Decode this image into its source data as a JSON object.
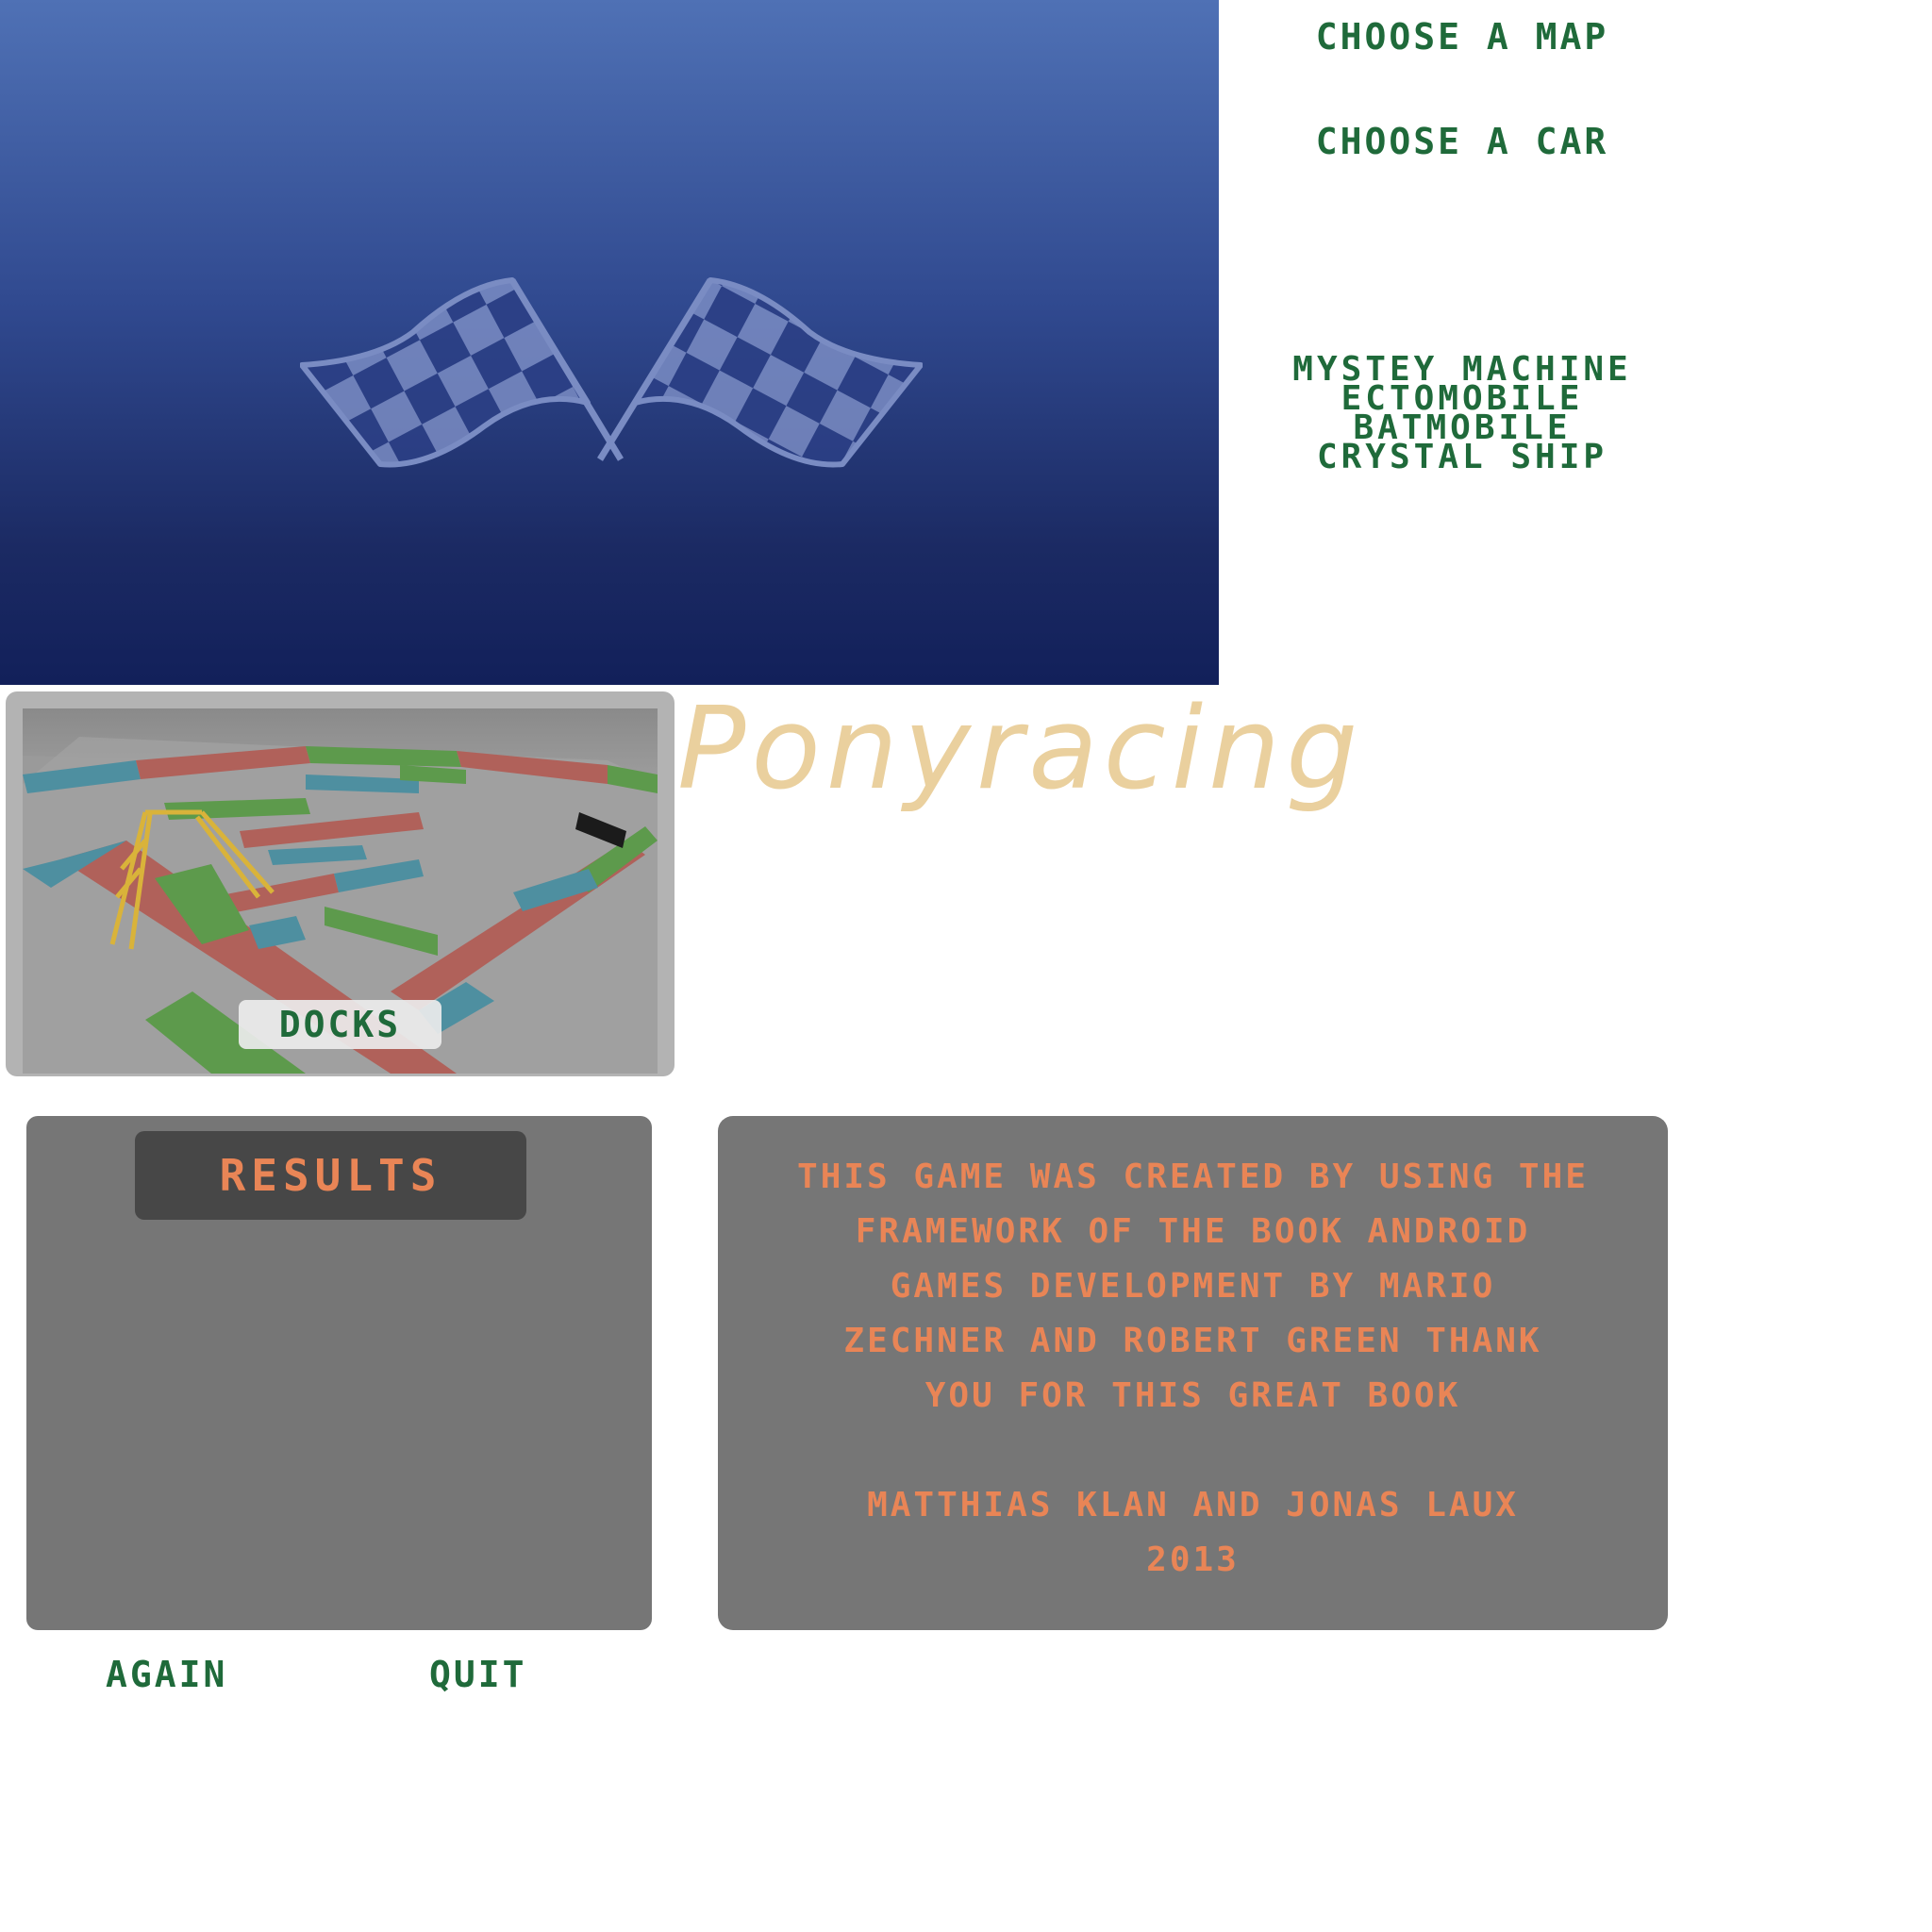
{
  "menu": {
    "choose_map_label": "CHOOSE A MAP",
    "choose_car_label": "CHOOSE A CAR",
    "cars": [
      "MYSTEY MACHINE",
      "ECTOMOBILE",
      "BATMOBILE",
      "CRYSTAL SHIP"
    ]
  },
  "map_card": {
    "map_name": "DOCKS"
  },
  "title": "Ponyracing",
  "results": {
    "header": "RESULTS"
  },
  "credits": {
    "lines": [
      "THIS GAME WAS CREATED BY USING THE",
      "FRAMEWORK OF THE BOOK ANDROID",
      "GAMES DEVELOPMENT BY MARIO",
      "ZECHNER AND ROBERT GREEN  THANK",
      "YOU FOR THIS GREAT BOOK",
      "",
      "MATTHIAS KLAN AND JONAS LAUX",
      "2013"
    ]
  },
  "buttons": {
    "again": "AGAIN",
    "quit": "QUIT"
  },
  "colors": {
    "menu_text": "#1f6a3a",
    "accent_text": "#e98556",
    "title_text": "#ead09e",
    "panel": "#767676",
    "header_panel": "#474747",
    "bg_top": "#4f71b5",
    "bg_bottom": "#12205a"
  },
  "icons": {
    "flags": "checkered-flags-icon"
  }
}
